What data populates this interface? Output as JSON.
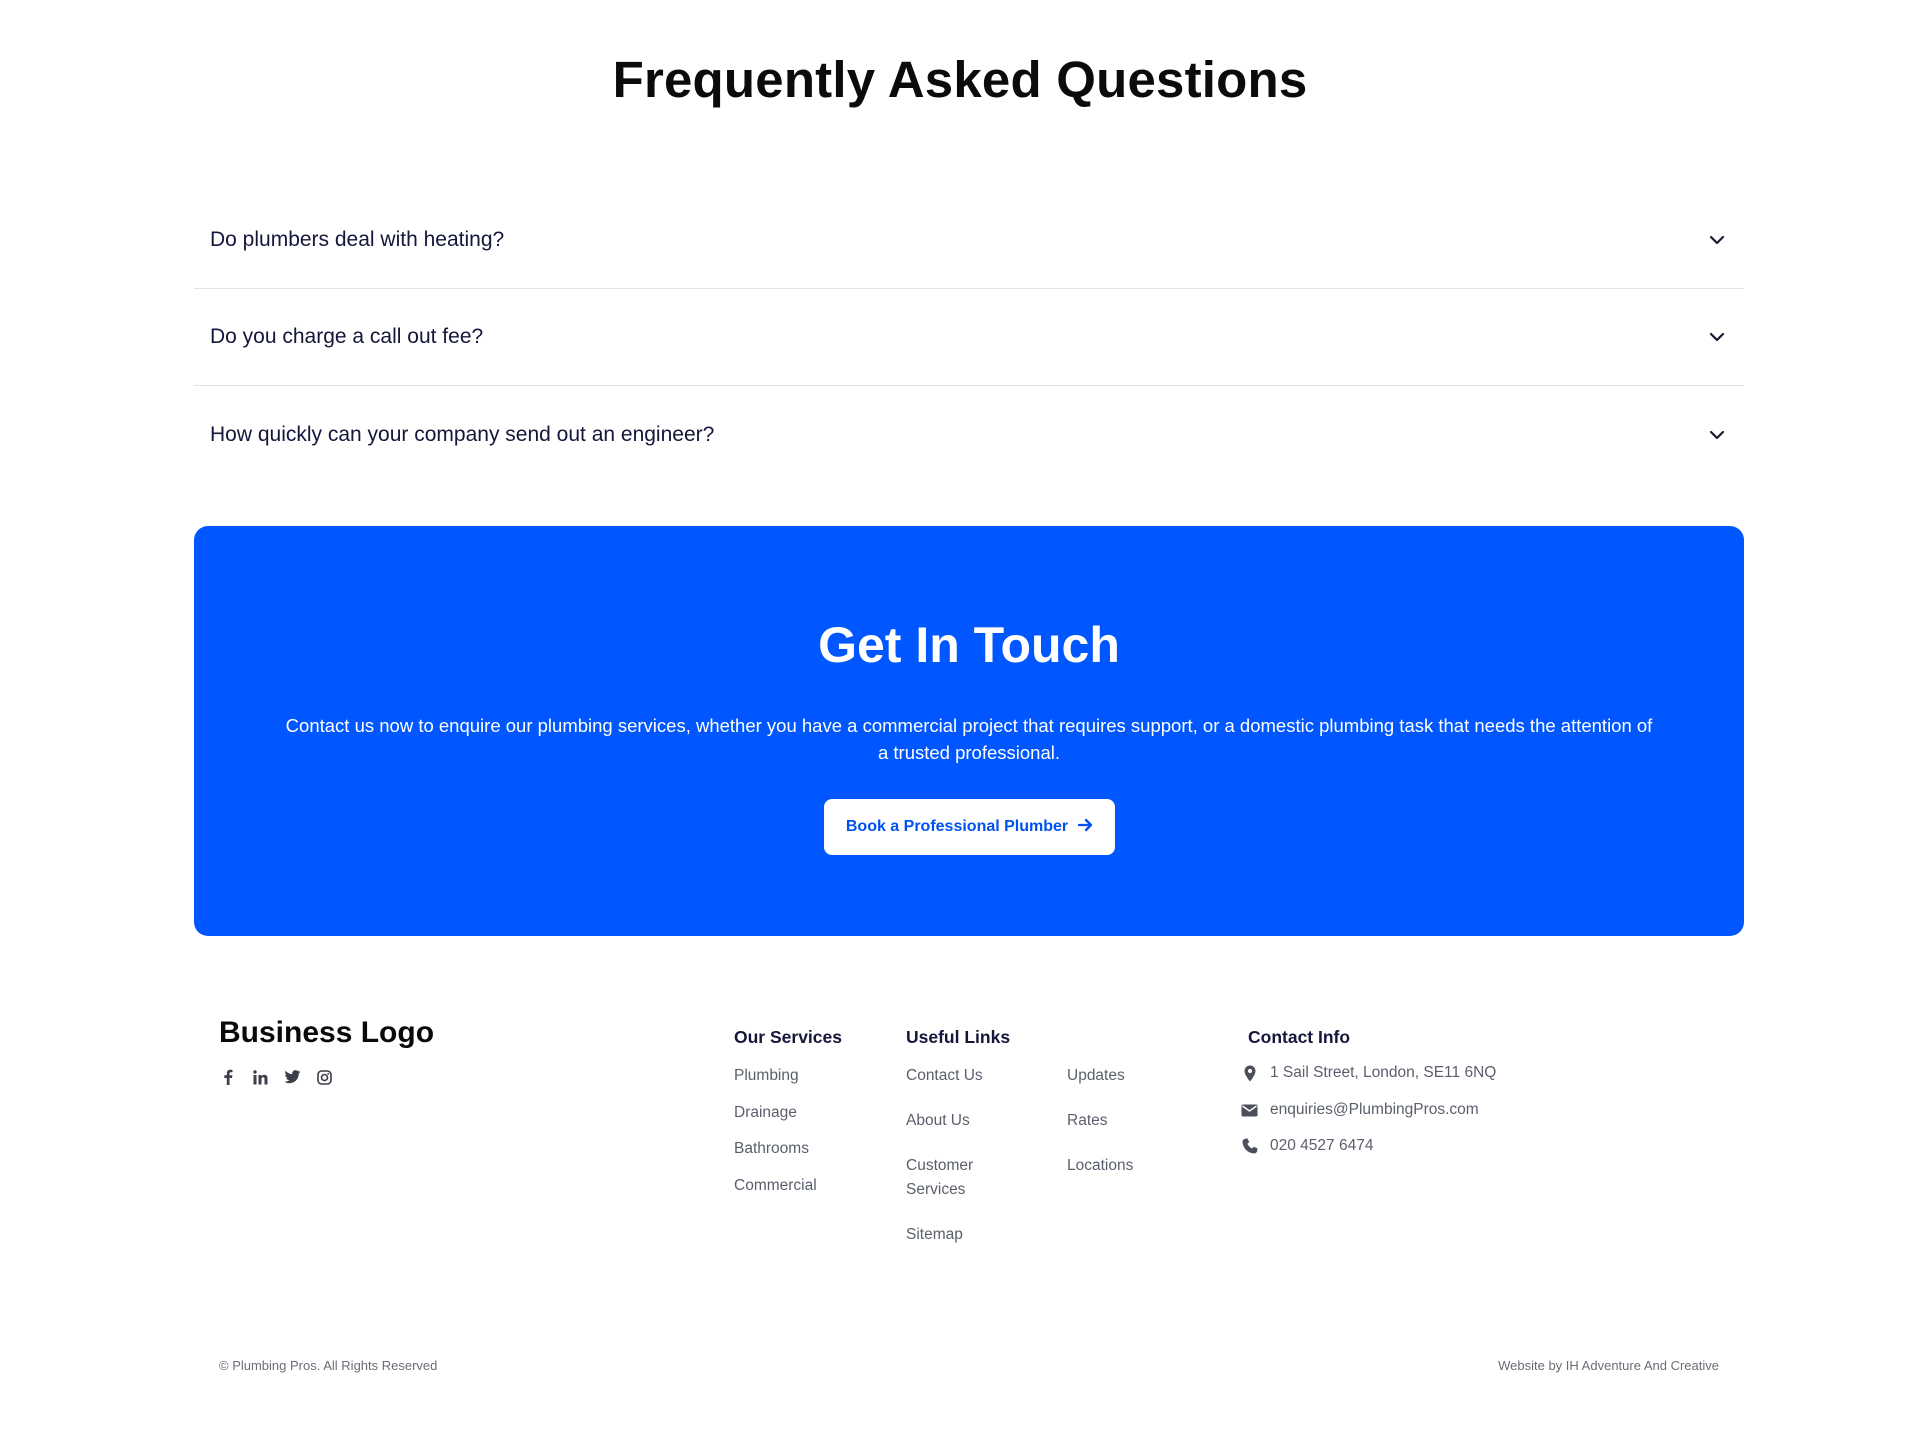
{
  "faq": {
    "title": "Frequently Asked Questions",
    "questions": [
      "Do plumbers deal with heating?",
      "Do you charge a call out fee?",
      "How quickly can your company send out an engineer?"
    ]
  },
  "cta": {
    "title": "Get In Touch",
    "text": "Contact us now to enquire our plumbing services, whether you have a commercial project that requires support, or a domestic plumbing task that needs the attention of a trusted professional.",
    "button_label": "Book a Professional Plumber",
    "colors": {
      "background": "#0057ff",
      "button_text": "#0052f0"
    }
  },
  "footer": {
    "logo": "Business Logo",
    "socials": [
      "facebook-icon",
      "linkedin-icon",
      "twitter-icon",
      "instagram-icon"
    ],
    "services": {
      "heading": "Our Services",
      "links": [
        "Plumbing",
        "Drainage",
        "Bathrooms",
        "Commercial"
      ]
    },
    "useful": {
      "heading": "Useful Links",
      "col1": [
        "Contact Us",
        "About Us",
        "Customer Services",
        "Sitemap"
      ],
      "col2": [
        "Updates",
        "Rates",
        "Locations"
      ]
    },
    "contact": {
      "heading": "Contact Info",
      "address": "1 Sail Street, London, SE11 6NQ",
      "email": "enquiries@PlumbingPros.com",
      "phone": "020 4527 6474"
    },
    "copyright": "© Plumbing Pros. All Rights Reserved",
    "credit": "Website by IH Adventure And Creative"
  }
}
